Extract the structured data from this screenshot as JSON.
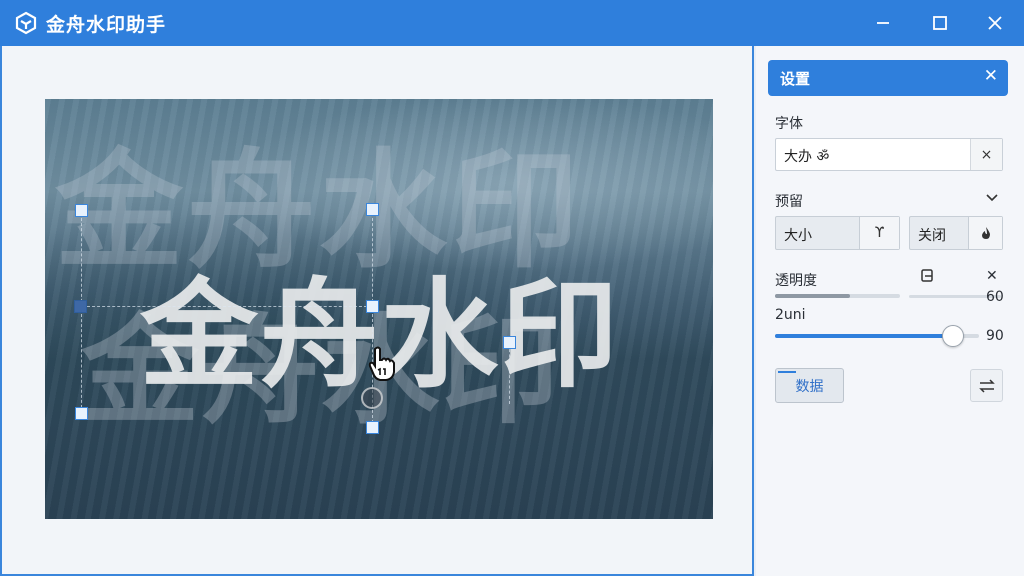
{
  "window": {
    "title": "金舟水印助手",
    "accent": "#2f7fdc",
    "controls": {
      "minimize": "minimize-icon",
      "maximize": "maximize-icon",
      "close": "close-icon"
    }
  },
  "canvas": {
    "watermark_text": "金舟水印",
    "ghost_text_1": "金舟水印",
    "ghost_text_2": "金舟水印",
    "cursor": "hand-cursor-icon"
  },
  "panel": {
    "title": "设置",
    "font": {
      "label": "字体",
      "value": "大办 ॐ",
      "clear": "×"
    },
    "preset": {
      "label": "预留",
      "left_label": "大小",
      "left_icon": "ϒ",
      "right_label": "关闭",
      "right_icon": "flame-icon"
    },
    "opacity": {
      "label": "透明度",
      "value_1": "60",
      "reset_icon": "✕",
      "copy_icon": "copy-icon"
    },
    "size": {
      "label": "2uni",
      "value": "90",
      "level": 0.86
    },
    "data_button": "数据",
    "swap_icon": "swap-icon"
  }
}
